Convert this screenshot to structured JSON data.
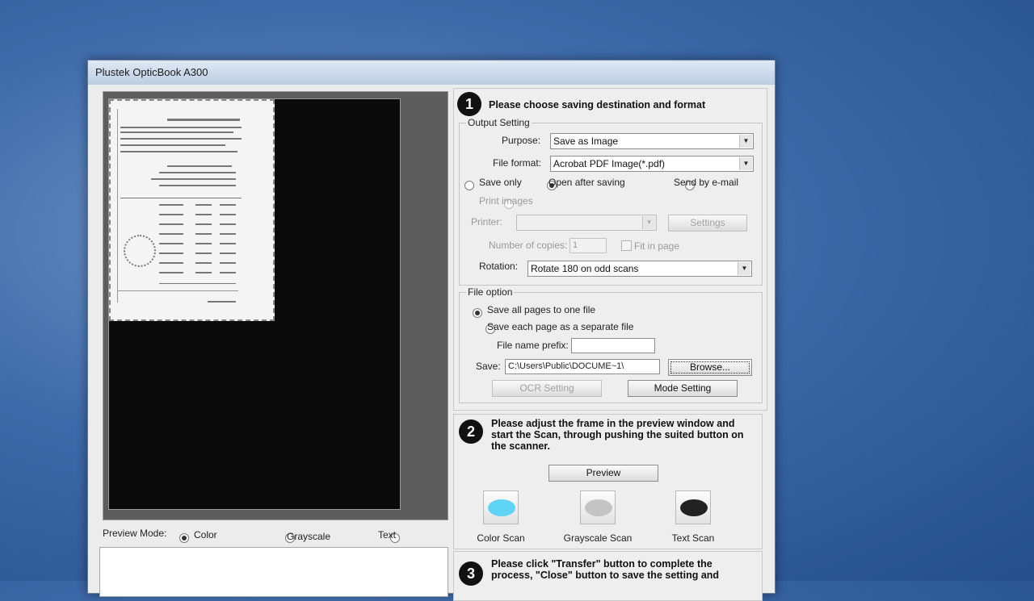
{
  "window": {
    "title": "Plustek OpticBook A300"
  },
  "preview_mode": {
    "label": "Preview Mode:",
    "options": [
      {
        "label": "Color",
        "selected": true
      },
      {
        "label": "Grayscale",
        "selected": false
      },
      {
        "label": "Text",
        "selected": false
      }
    ]
  },
  "step1": {
    "number": "1",
    "title": "Please choose saving destination and format",
    "output_setting": {
      "group_label": "Output Setting",
      "purpose_label": "Purpose:",
      "purpose_value": "Save as Image",
      "file_format_label": "File format:",
      "file_format_value": "Acrobat PDF Image(*.pdf)",
      "save_only": "Save only",
      "open_after_saving": "Open after saving",
      "send_by_email": "Send by e-mail",
      "print_images": "Print images",
      "printer_label": "Printer:",
      "printer_value": "",
      "settings_button": "Settings",
      "copies_label": "Number of copies:",
      "copies_value": "1",
      "fit_in_page": "Fit in page",
      "rotation_label": "Rotation:",
      "rotation_value": "Rotate 180 on odd scans"
    },
    "file_option": {
      "group_label": "File option",
      "save_all": "Save all pages to one file",
      "save_each": "Save each page as a separate file",
      "prefix_label": "File name prefix:",
      "prefix_value": "",
      "save_label": "Save:",
      "save_path": "C:\\Users\\Public\\DOCUME~1\\",
      "browse_button": "Browse...",
      "ocr_button": "OCR Setting",
      "mode_button": "Mode Setting"
    }
  },
  "step2": {
    "number": "2",
    "text": "Please adjust the frame in the preview window and start the Scan, through pushing the suited button on the scanner.",
    "preview_button": "Preview",
    "scan_buttons": [
      {
        "label": "Color Scan",
        "color": "#5fd4f5"
      },
      {
        "label": "Grayscale Scan",
        "color": "#c4c4c4"
      },
      {
        "label": "Text Scan",
        "color": "#222222"
      }
    ]
  },
  "step3": {
    "number": "3",
    "text": "Please click \"Transfer\" button to complete the process, \"Close\" button to save the setting and"
  }
}
